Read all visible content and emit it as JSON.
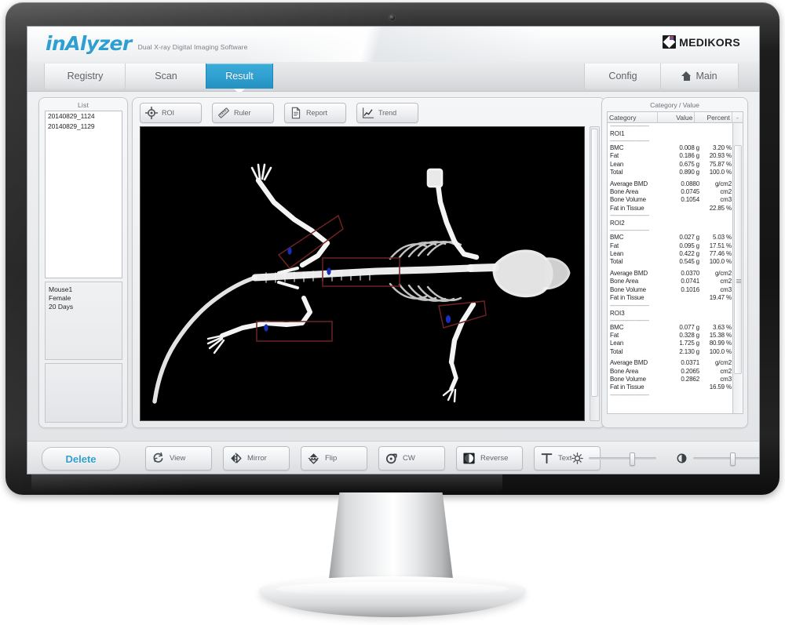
{
  "device": {
    "type": "desktop-monitor"
  },
  "header": {
    "logo": "inAlyzer",
    "tagline": "Dual X-ray Digital Imaging Software",
    "brand": "MEDIKORS"
  },
  "tabs": {
    "registry": "Registry",
    "scan": "Scan",
    "result": "Result",
    "config": "Config",
    "main": "Main",
    "active": "Result"
  },
  "sidebar": {
    "list_title": "List",
    "items": [
      {
        "label": "20140829_1124"
      },
      {
        "label": "20140829_1129"
      }
    ],
    "info": {
      "subject": "Mouse1",
      "sex": "Female",
      "age": "20 Days"
    }
  },
  "image_toolbar": {
    "buttons": [
      {
        "label": "ROI",
        "icon": "crosshair-icon"
      },
      {
        "label": "Ruler",
        "icon": "ruler-icon"
      },
      {
        "label": "Report",
        "icon": "document-icon"
      },
      {
        "label": "Trend",
        "icon": "line-chart-icon"
      }
    ]
  },
  "xray": {
    "subject": "mouse-dxa-skeleton",
    "background": "#000000",
    "roi_boxes": [
      {
        "id": "1",
        "marker_color": "#1a2fb8",
        "outline_color": "#6e2222"
      },
      {
        "id": "3",
        "marker_color": "#1a2fb8",
        "outline_color": "#6e2222"
      },
      {
        "id": "2",
        "marker_color": "#1a2fb8",
        "outline_color": "#6e2222"
      },
      {
        "id": "0",
        "marker_color": "#1a2fb8",
        "outline_color": "#6e2222"
      }
    ]
  },
  "data_panel": {
    "title": "Category / Value",
    "columns": {
      "category": "Category",
      "value": "Value",
      "percent": "Percent",
      "more": "-"
    },
    "groups": [
      {
        "name": "ROI1",
        "composition": [
          {
            "category": "BMC",
            "value": "0.008 g",
            "percent": "3.20 %"
          },
          {
            "category": "Fat",
            "value": "0.186 g",
            "percent": "20.93 %"
          },
          {
            "category": "Lean",
            "value": "0.675 g",
            "percent": "75.87 %"
          },
          {
            "category": "Total",
            "value": "0.890 g",
            "percent": "100.0 %"
          }
        ],
        "density": [
          {
            "category": "Average BMD",
            "value": "0.0880",
            "percent": "g/cm2"
          },
          {
            "category": "Bone Area",
            "value": "0.0745",
            "percent": "cm2"
          },
          {
            "category": "Bone Volume",
            "value": "0.1054",
            "percent": "cm3"
          },
          {
            "category": "Fat in Tissue",
            "value": "",
            "percent": "22.85 %"
          }
        ]
      },
      {
        "name": "ROI2",
        "composition": [
          {
            "category": "BMC",
            "value": "0.027 g",
            "percent": "5.03 %"
          },
          {
            "category": "Fat",
            "value": "0.095 g",
            "percent": "17.51 %"
          },
          {
            "category": "Lean",
            "value": "0.422 g",
            "percent": "77.46 %"
          },
          {
            "category": "Total",
            "value": "0.545 g",
            "percent": "100.0 %"
          }
        ],
        "density": [
          {
            "category": "Average BMD",
            "value": "0.0370",
            "percent": "g/cm2"
          },
          {
            "category": "Bone Area",
            "value": "0.0741",
            "percent": "cm2"
          },
          {
            "category": "Bone Volume",
            "value": "0.1016",
            "percent": "cm3"
          },
          {
            "category": "Fat in Tissue",
            "value": "",
            "percent": "19.47 %"
          }
        ]
      },
      {
        "name": "ROI3",
        "composition": [
          {
            "category": "BMC",
            "value": "0.077 g",
            "percent": "3.63 %"
          },
          {
            "category": "Fat",
            "value": "0.328 g",
            "percent": "15.38 %"
          },
          {
            "category": "Lean",
            "value": "1.725 g",
            "percent": "80.99 %"
          },
          {
            "category": "Total",
            "value": "2.130 g",
            "percent": "100.0 %"
          }
        ],
        "density": [
          {
            "category": "Average BMD",
            "value": "0.0371",
            "percent": "g/cm2"
          },
          {
            "category": "Bone Area",
            "value": "0.2065",
            "percent": "cm2"
          },
          {
            "category": "Bone Volume",
            "value": "0.2862",
            "percent": "cm3"
          },
          {
            "category": "Fat in Tissue",
            "value": "",
            "percent": "16.59 %"
          }
        ]
      }
    ]
  },
  "bottom_bar": {
    "delete": "Delete",
    "tools": [
      {
        "label": "View",
        "icon": "rotate-view-icon"
      },
      {
        "label": "Mirror",
        "icon": "mirror-icon"
      },
      {
        "label": "Flip",
        "icon": "flip-icon"
      },
      {
        "label": "CW",
        "icon": "rotate-cw-icon"
      },
      {
        "label": "Reverse",
        "icon": "reverse-contrast-icon"
      },
      {
        "label": "Text",
        "icon": "text-tool-icon"
      }
    ],
    "brightness": {
      "icon": "brightness-icon",
      "position_pct": 62
    },
    "contrast": {
      "icon": "contrast-icon",
      "position_pct": 57
    }
  },
  "colors": {
    "accent": "#2e9fd0",
    "panel": "#eceef0",
    "screen_bg": "#e8e9eb",
    "roi_outline": "#6e2222",
    "roi_marker": "#1a2fb8"
  }
}
